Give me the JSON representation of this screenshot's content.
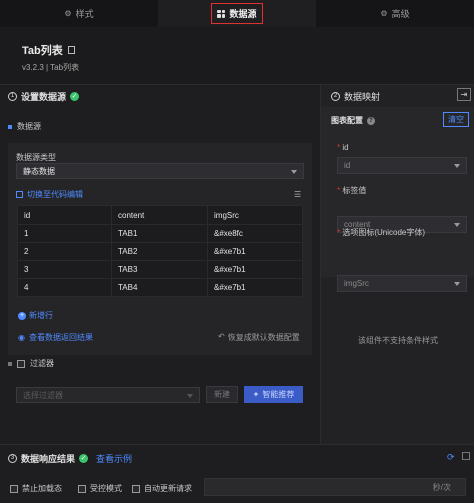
{
  "tabs": [
    {
      "label": "样式",
      "icon": "settings-icon"
    },
    {
      "label": "数据源",
      "icon": "grid-icon"
    },
    {
      "label": "高级",
      "icon": "gear-icon"
    }
  ],
  "component": {
    "title": "Tab列表",
    "version": "v3.2.3 | Tab列表"
  },
  "datasource_section": {
    "number": "1",
    "title": "设置数据源",
    "subtitle": "数据源",
    "type_label": "数据源类型",
    "type_value": "静态数据",
    "switch_code": "切换至代码编辑",
    "table": {
      "headers": [
        "id",
        "content",
        "imgSrc"
      ],
      "rows": [
        [
          "1",
          "TAB1",
          "&#xe8fc"
        ],
        [
          "2",
          "TAB2",
          "&#xe7b1"
        ],
        [
          "3",
          "TAB3",
          "&#xe7b1"
        ],
        [
          "4",
          "TAB4",
          "&#xe7b1"
        ]
      ]
    },
    "add_row": "新增行",
    "view_result": "查看数据返回结果",
    "restore_default": "恢复成默认数据配置"
  },
  "filter": {
    "label": "过滤器",
    "select_placeholder": "选择过滤器",
    "new_button": "新建",
    "smart_button": "智能推荐"
  },
  "mapping_section": {
    "number": "2",
    "title": "数据映射",
    "config_label": "图表配置",
    "clear_button": "清空",
    "fields": [
      {
        "label": "id",
        "value": "id"
      },
      {
        "label": "标签值",
        "value": "content"
      },
      {
        "label": "选项图标(Unicode字体)",
        "value": "imgSrc"
      }
    ],
    "unsupported_text": "该组件不支持条件样式"
  },
  "response_section": {
    "number": "3",
    "title": "数据响应结果",
    "view_example": "查看示例",
    "options": [
      "禁止加载态",
      "受控模式",
      "自动更新请求"
    ],
    "rate_unit": "秒/次"
  }
}
